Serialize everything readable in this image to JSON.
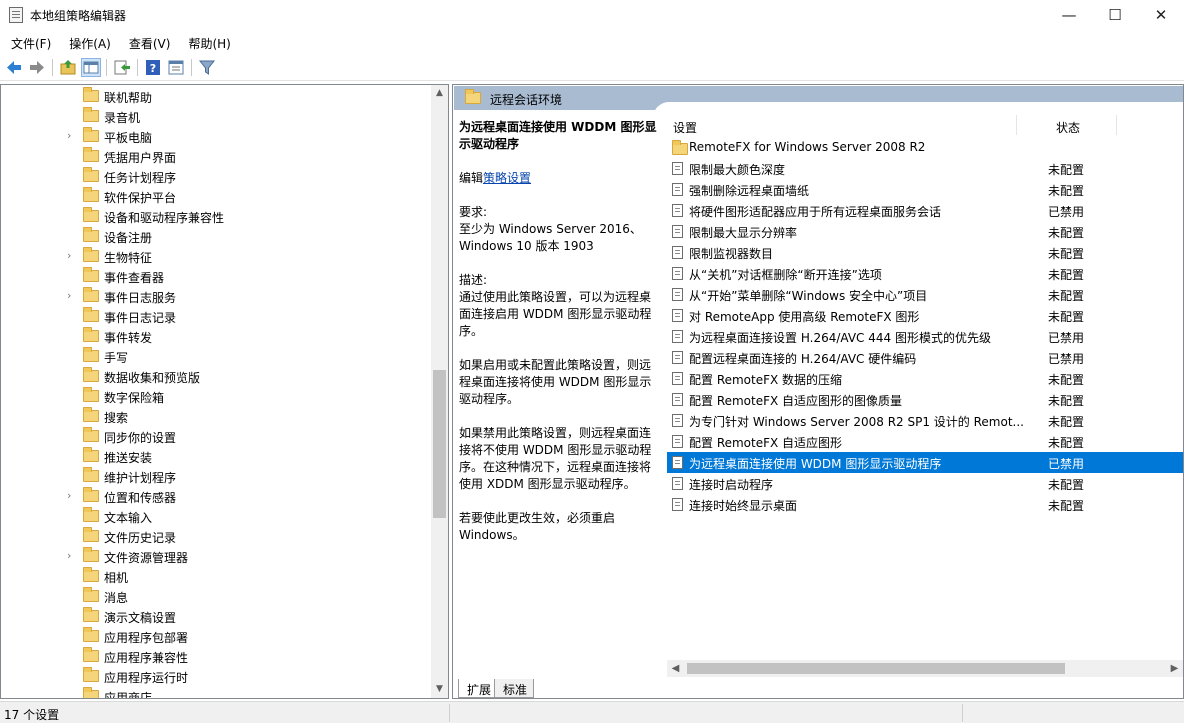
{
  "window": {
    "title": "本地组策略编辑器",
    "minimize": "—",
    "maximize": "☐",
    "close": "✕"
  },
  "menu": [
    "文件(F)",
    "操作(A)",
    "查看(V)",
    "帮助(H)"
  ],
  "toolbar_icons": [
    "back-icon",
    "forward-icon",
    "up-folder-icon",
    "show-hide-tree-icon",
    "export-list-icon",
    "help-icon",
    "properties-icon",
    "filter-icon"
  ],
  "tree": {
    "items": [
      {
        "label": "联机帮助",
        "expandable": false
      },
      {
        "label": "录音机",
        "expandable": false
      },
      {
        "label": "平板电脑",
        "expandable": true
      },
      {
        "label": "凭据用户界面",
        "expandable": false
      },
      {
        "label": "任务计划程序",
        "expandable": false
      },
      {
        "label": "软件保护平台",
        "expandable": false
      },
      {
        "label": "设备和驱动程序兼容性",
        "expandable": false
      },
      {
        "label": "设备注册",
        "expandable": false
      },
      {
        "label": "生物特征",
        "expandable": true
      },
      {
        "label": "事件查看器",
        "expandable": false
      },
      {
        "label": "事件日志服务",
        "expandable": true
      },
      {
        "label": "事件日志记录",
        "expandable": false
      },
      {
        "label": "事件转发",
        "expandable": false
      },
      {
        "label": "手写",
        "expandable": false
      },
      {
        "label": "数据收集和预览版",
        "expandable": false
      },
      {
        "label": "数字保险箱",
        "expandable": false
      },
      {
        "label": "搜索",
        "expandable": false
      },
      {
        "label": "同步你的设置",
        "expandable": false
      },
      {
        "label": "推送安装",
        "expandable": false
      },
      {
        "label": "维护计划程序",
        "expandable": false
      },
      {
        "label": "位置和传感器",
        "expandable": true
      },
      {
        "label": "文本输入",
        "expandable": false
      },
      {
        "label": "文件历史记录",
        "expandable": false
      },
      {
        "label": "文件资源管理器",
        "expandable": true
      },
      {
        "label": "相机",
        "expandable": false
      },
      {
        "label": "消息",
        "expandable": false
      },
      {
        "label": "演示文稿设置",
        "expandable": false
      },
      {
        "label": "应用程序包部署",
        "expandable": false
      },
      {
        "label": "应用程序兼容性",
        "expandable": false
      },
      {
        "label": "应用程序运行时",
        "expandable": false
      },
      {
        "label": "应用商店",
        "expandable": false
      }
    ]
  },
  "right": {
    "header": "远程会话环境",
    "description": {
      "heading": "为远程桌面连接使用 WDDM 图形显示驱动程序",
      "edit_prefix": "编辑",
      "edit_link": "策略设置",
      "requirements_label": "要求:",
      "requirements_text": "至少为 Windows Server 2016、Windows 10 版本 1903",
      "desc_label": "描述:",
      "desc_text": "通过使用此策略设置，可以为远程桌面连接启用 WDDM 图形显示驱动程序。",
      "para2": "如果启用或未配置此策略设置，则远程桌面连接将使用 WDDM 图形显示驱动程序。",
      "para3": "如果禁用此策略设置，则远程桌面连接将不使用 WDDM 图形显示驱动程序。在这种情况下，远程桌面连接将使用 XDDM 图形显示驱动程序。",
      "para4": "若要使此更改生效，必须重启 Windows。"
    },
    "columns": {
      "setting": "设置",
      "state": "状态"
    },
    "rows": [
      {
        "name": "RemoteFX for Windows Server 2008 R2",
        "state": "",
        "folder": true
      },
      {
        "name": "限制最大颜色深度",
        "state": "未配置"
      },
      {
        "name": "强制删除远程桌面墙纸",
        "state": "未配置"
      },
      {
        "name": "将硬件图形适配器应用于所有远程桌面服务会话",
        "state": "已禁用"
      },
      {
        "name": "限制最大显示分辨率",
        "state": "未配置"
      },
      {
        "name": "限制监视器数目",
        "state": "未配置"
      },
      {
        "name": "从“关机”对话框删除“断开连接”选项",
        "state": "未配置"
      },
      {
        "name": "从“开始”菜单删除“Windows 安全中心”项目",
        "state": "未配置"
      },
      {
        "name": "对 RemoteApp 使用高级 RemoteFX 图形",
        "state": "未配置"
      },
      {
        "name": "为远程桌面连接设置 H.264/AVC 444 图形模式的优先级",
        "state": "已禁用"
      },
      {
        "name": "配置远程桌面连接的 H.264/AVC 硬件编码",
        "state": "已禁用"
      },
      {
        "name": "配置 RemoteFX 数据的压缩",
        "state": "未配置"
      },
      {
        "name": "配置 RemoteFX 自适应图形的图像质量",
        "state": "未配置"
      },
      {
        "name": "为专门针对 Windows Server 2008 R2 SP1 设计的 Remot...",
        "state": "未配置"
      },
      {
        "name": "配置 RemoteFX 自适应图形",
        "state": "未配置"
      },
      {
        "name": "为远程桌面连接使用 WDDM 图形显示驱动程序",
        "state": "已禁用",
        "selected": true
      },
      {
        "name": "连接时启动程序",
        "state": "未配置"
      },
      {
        "name": "连接时始终显示桌面",
        "state": "未配置"
      }
    ],
    "tabs": [
      "扩展",
      "标准"
    ]
  },
  "status": {
    "text": "17 个设置"
  },
  "colors": {
    "selection": "#0078d7",
    "header": "#a9bbd1",
    "link": "#0645ad"
  }
}
